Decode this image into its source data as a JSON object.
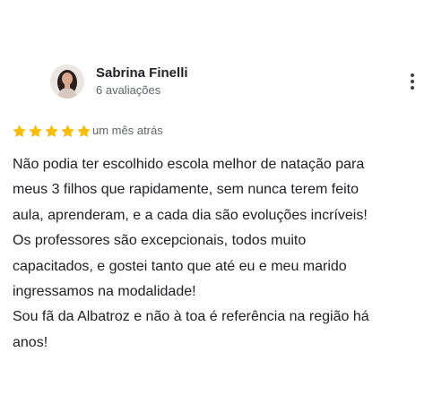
{
  "reviewer": {
    "name": "Sabrina Finelli",
    "review_count": "6 avaliações",
    "avatar_icon": "profile-photo"
  },
  "menu": {
    "icon": "more-vert-icon"
  },
  "rating": {
    "stars": 5,
    "max_stars": 5,
    "star_color": "#fbbc04",
    "date": "um mês atrás"
  },
  "review": {
    "lines": [
      "Não podia ter escolhido escola melhor de natação para",
      "meus 3 filhos que rapidamente, sem nunca terem feito",
      "aula, aprenderam, e a cada dia são evoluções incríveis!",
      "Os professores são excepcionais, todos muito",
      "capacitados, e gostei tanto que até eu e meu marido",
      "ingressamos na modalidade!",
      "Sou fã da Albatroz e não à toa é referência na região há",
      "anos!"
    ]
  }
}
